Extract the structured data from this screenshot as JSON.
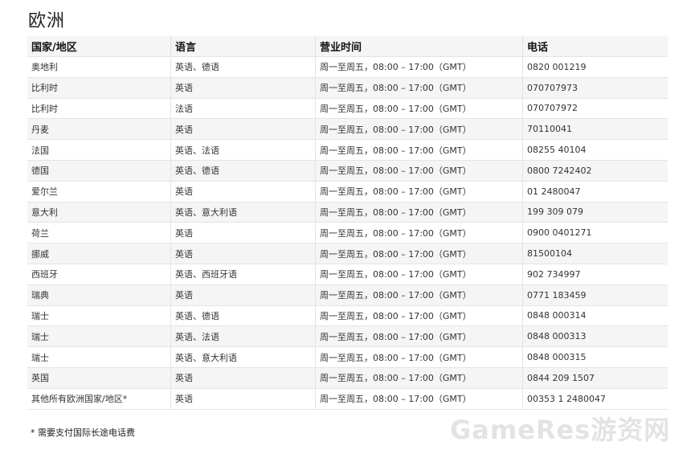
{
  "page": {
    "title": "欧洲",
    "footnote": "* 需要支付国际长途电话费",
    "watermark": "GameRes游资网"
  },
  "table": {
    "headers": [
      "国家/地区",
      "语言",
      "营业时间",
      "电话"
    ],
    "rows": [
      [
        "奥地利",
        "英语、德语",
        "周一至周五，08:00 – 17:00（GMT）",
        "0820 001219"
      ],
      [
        "比利时",
        "英语",
        "周一至周五，08:00 – 17:00（GMT）",
        "070707973"
      ],
      [
        "比利时",
        "法语",
        "周一至周五，08:00 – 17:00（GMT）",
        "070707972"
      ],
      [
        "丹麦",
        "英语",
        "周一至周五，08:00 – 17:00（GMT）",
        "70110041"
      ],
      [
        "法国",
        "英语、法语",
        "周一至周五，08:00 – 17:00（GMT）",
        "08255 40104"
      ],
      [
        "德国",
        "英语、德语",
        "周一至周五，08:00 – 17:00（GMT）",
        "0800 7242402"
      ],
      [
        "爱尔兰",
        "英语",
        "周一至周五，08:00 – 17:00（GMT）",
        "01 2480047"
      ],
      [
        "意大利",
        "英语、意大利语",
        "周一至周五，08:00 – 17:00（GMT）",
        "199 309 079"
      ],
      [
        "荷兰",
        "英语",
        "周一至周五，08:00 – 17:00（GMT）",
        "0900 0401271"
      ],
      [
        "挪威",
        "英语",
        "周一至周五，08:00 – 17:00（GMT）",
        "81500104"
      ],
      [
        "西班牙",
        "英语、西班牙语",
        "周一至周五，08:00 – 17:00（GMT）",
        "902 734997"
      ],
      [
        "瑞典",
        "英语",
        "周一至周五，08:00 – 17:00（GMT）",
        "0771 183459"
      ],
      [
        "瑞士",
        "英语、德语",
        "周一至周五，08:00 – 17:00（GMT）",
        "0848 000314"
      ],
      [
        "瑞士",
        "英语、法语",
        "周一至周五，08:00 – 17:00（GMT）",
        "0848 000313"
      ],
      [
        "瑞士",
        "英语、意大利语",
        "周一至周五，08:00 – 17:00（GMT）",
        "0848 000315"
      ],
      [
        "英国",
        "英语",
        "周一至周五，08:00 – 17:00（GMT）",
        "0844 209 1507"
      ],
      [
        "其他所有欧洲国家/地区*",
        "英语",
        "周一至周五，08:00 – 17:00（GMT）",
        "00353 1 2480047"
      ]
    ]
  }
}
